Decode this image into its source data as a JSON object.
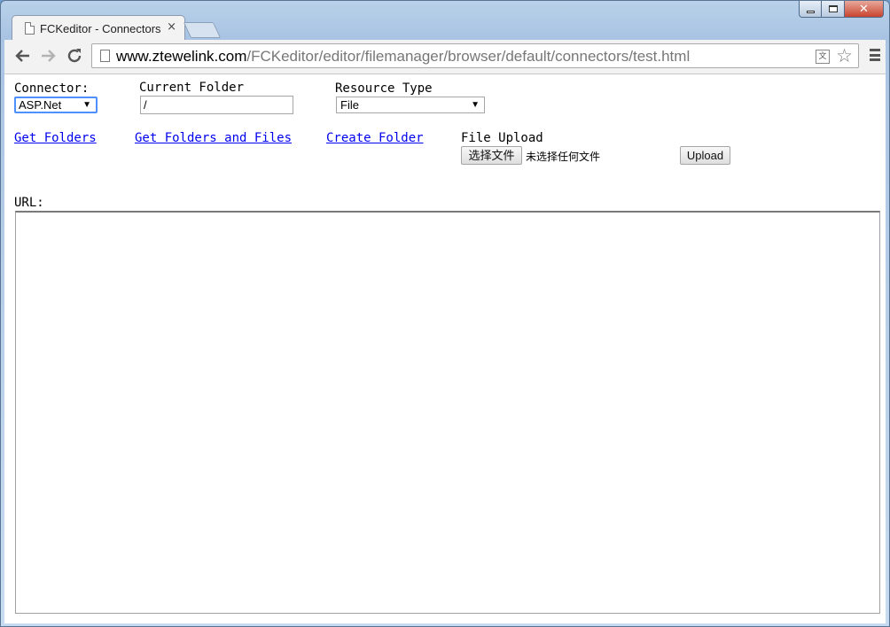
{
  "browser": {
    "tab_title": "FCKeditor - Connectors",
    "tab_close": "×",
    "url_host": "www.ztewelink.com",
    "url_path": "/FCKeditor/editor/filemanager/browser/default/connectors/test.html"
  },
  "form": {
    "connector_label": "Connector:",
    "connector_value": "ASP.Net",
    "current_folder_label": "Current Folder",
    "current_folder_value": "/",
    "resource_type_label": "Resource Type",
    "resource_type_value": "File"
  },
  "actions": {
    "get_folders": "Get Folders",
    "get_folders_files": "Get Folders and Files",
    "create_folder": "Create Folder",
    "file_upload_label": "File Upload",
    "choose_file_button": "选择文件",
    "no_file_chosen": "未选择任何文件",
    "upload_button": "Upload"
  },
  "url_label": "URL:",
  "icons": [
    "page-icon",
    "back-arrow-icon",
    "forward-arrow-icon",
    "reload-icon",
    "translate-icon",
    "star-icon",
    "menu-icon",
    "minimize-icon",
    "maximize-icon",
    "close-icon"
  ]
}
